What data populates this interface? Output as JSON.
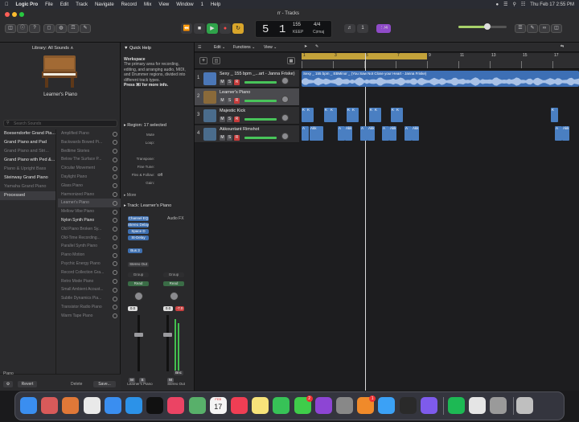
{
  "menubar": {
    "app": "Logic Pro",
    "items": [
      "File",
      "Edit",
      "Track",
      "Navigate",
      "Record",
      "Mix",
      "View",
      "Window",
      "1",
      "Help"
    ],
    "clock": "Thu Feb 17  2:55 PM"
  },
  "window": {
    "title": "rr - Tracks"
  },
  "lcd": {
    "bar": "5",
    "beat": "1",
    "tempo": "155",
    "tempo_sub": "KEEP",
    "sig": "4/4",
    "key": "C♯maj"
  },
  "toolbar": {
    "badge": "⋮/4"
  },
  "library": {
    "title": "Library:  All Sounds ∧",
    "patch_name": "Learner's Piano",
    "search_placeholder": "Search Sounds",
    "left_items": [
      {
        "label": "Boesendorfer Grand Pia...",
        "dim": false
      },
      {
        "label": "Grand Piano and Pad",
        "dim": false
      },
      {
        "label": "Grand Piano and Stri...",
        "dim": true
      },
      {
        "label": "Grand Piano with Ped &...",
        "dim": false
      },
      {
        "label": "Piano & Upright Bass",
        "dim": true
      },
      {
        "label": "Steinway Grand Piano",
        "dim": false
      },
      {
        "label": "Yamaha Grand Piano",
        "dim": true
      },
      {
        "label": "Processed",
        "dim": false
      }
    ],
    "right_items": [
      {
        "label": "Amplified Piano",
        "state": "dim"
      },
      {
        "label": "Backwards Bowed Pi...",
        "state": "dim"
      },
      {
        "label": "Bedtime Stories",
        "state": "dim"
      },
      {
        "label": "Below The Surface P...",
        "state": "dim"
      },
      {
        "label": "Circular Movement",
        "state": "dim"
      },
      {
        "label": "Daylight Piano",
        "state": "dim"
      },
      {
        "label": "Glass Piano",
        "state": "dim"
      },
      {
        "label": "Harmonized Piano",
        "state": "dim"
      },
      {
        "label": "Learner's Piano",
        "state": "selected"
      },
      {
        "label": "Mellow Vibe Piano",
        "state": "dim"
      },
      {
        "label": "Nylon Synth Piano",
        "state": "bright"
      },
      {
        "label": "Old Piano Broken Sy...",
        "state": "dim"
      },
      {
        "label": "Old-Time Recording...",
        "state": "dim"
      },
      {
        "label": "Parallel Synth Piano",
        "state": "dim"
      },
      {
        "label": "Piano Motion",
        "state": "dim"
      },
      {
        "label": "Psychic Energy Piano",
        "state": "dim"
      },
      {
        "label": "Record Collection Gra...",
        "state": "dim"
      },
      {
        "label": "Retro Mode Piano",
        "state": "dim"
      },
      {
        "label": "Small Ambient Acoust...",
        "state": "dim"
      },
      {
        "label": "Subtle Dynamics Pia...",
        "state": "dim"
      },
      {
        "label": "Transistor Radio Piano",
        "state": "dim"
      },
      {
        "label": "Warm Tape Piano",
        "state": "dim"
      }
    ],
    "footer_left": "Piano",
    "revert": "Revert",
    "delete": "Delete",
    "save": "Save..."
  },
  "quickhelp": {
    "title": "Quick Help",
    "heading": "Workspace",
    "body": "The primary area for recording, editing, and arranging audio, MIDI, and Drummer regions, divided into different track types.",
    "tip": "Press ⌘/ for more info.",
    "region_title": "Region: 17 selected",
    "region_rows": [
      {
        "k": "Mute",
        "v": ""
      },
      {
        "k": "Loop:",
        "v": ""
      },
      {
        "k": "",
        "v": ""
      },
      {
        "k": "Transpose:",
        "v": ""
      },
      {
        "k": "Fine Tune:",
        "v": ""
      },
      {
        "k": "Flex & Follow:",
        "v": "Off"
      },
      {
        "k": "Gain:",
        "v": ""
      }
    ],
    "more": "More",
    "track_title": "Track:  Learner's Piano",
    "plugins": [
      "Channel EQ",
      "Stereo Delay",
      "Space D",
      "St-Delay"
    ],
    "audio_fx": "Audio FX",
    "bus": "Bus 3",
    "stereo_out": "Stereo Out",
    "group": "Group",
    "read": "Read",
    "vol_left": "0.0",
    "vol_right": "0.0",
    "vol_right2": "-7.0",
    "bnc": "Bnc",
    "strip_left_name": "Learner's Piano",
    "strip_right_name": "Stereo Out",
    "m": "M",
    "s": "S",
    "i": "I"
  },
  "tracks": {
    "toolbar": {
      "edit": "Edit",
      "functions": "Functions",
      "view": "View"
    },
    "ruler": [
      "1",
      "3",
      "5",
      "7",
      "9",
      "11",
      "13",
      "15",
      "17"
    ],
    "list": [
      {
        "num": "1",
        "name": "Sexy _ 155 bpm _...art - Janna Friske)",
        "color": "#4b77b7",
        "selected": false
      },
      {
        "num": "2",
        "name": "Learner's Piano",
        "color": "#8a6a3a",
        "selected": true
      },
      {
        "num": "3",
        "name": "Majestic Kick",
        "color": "#4a6c8c",
        "selected": false
      },
      {
        "num": "4",
        "name": "Akkountant Rimshot",
        "color": "#4a6c8c",
        "selected": false
      }
    ],
    "audio_region": "Sexy _ 155 bpm _ EBMinor _ (You Saw Not Close your Heart - Janna Friske)",
    "kick_label": "K",
    "rim_label": "A",
    "rim_label2": "Akk"
  },
  "dock": {
    "apps": [
      {
        "name": "Finder",
        "color": "#3a8ef0"
      },
      {
        "name": "Launchpad",
        "color": "#d85a5a"
      },
      {
        "name": "Photos",
        "color": "#e07838"
      },
      {
        "name": "Chrome",
        "color": "#e9e9e9"
      },
      {
        "name": "Mail",
        "color": "#3a8ef0"
      },
      {
        "name": "Safari",
        "color": "#2c92e8"
      },
      {
        "name": "AppleTV",
        "color": "#111111"
      },
      {
        "name": "Music",
        "color": "#eb4464"
      },
      {
        "name": "Maps",
        "color": "#58b06a"
      },
      {
        "name": "Calendar",
        "color": "#f4f4f4"
      },
      {
        "name": "Music2",
        "color": "#f03e54"
      },
      {
        "name": "Notes",
        "color": "#f7e37a"
      },
      {
        "name": "FaceTime",
        "color": "#37c257"
      },
      {
        "name": "Messages",
        "color": "#3fcd4a"
      },
      {
        "name": "Podcasts",
        "color": "#8d45d4"
      },
      {
        "name": "Settings",
        "color": "#888888"
      },
      {
        "name": "Books",
        "color": "#f08a2a"
      },
      {
        "name": "AppStore",
        "color": "#3ba1f6"
      },
      {
        "name": "Logic",
        "color": "#2a2a2a"
      },
      {
        "name": "Shortcuts",
        "color": "#7e5bec"
      },
      {
        "name": "Spotify",
        "color": "#1db954"
      },
      {
        "name": "Roblox",
        "color": "#e5e5e5"
      },
      {
        "name": "Disk",
        "color": "#9a9a9a"
      },
      {
        "name": "Trash",
        "color": "#bfbfbf"
      }
    ],
    "calendar_day": "17",
    "calendar_month": "FEB",
    "mail_badge": "1",
    "messages_badge": "2"
  }
}
